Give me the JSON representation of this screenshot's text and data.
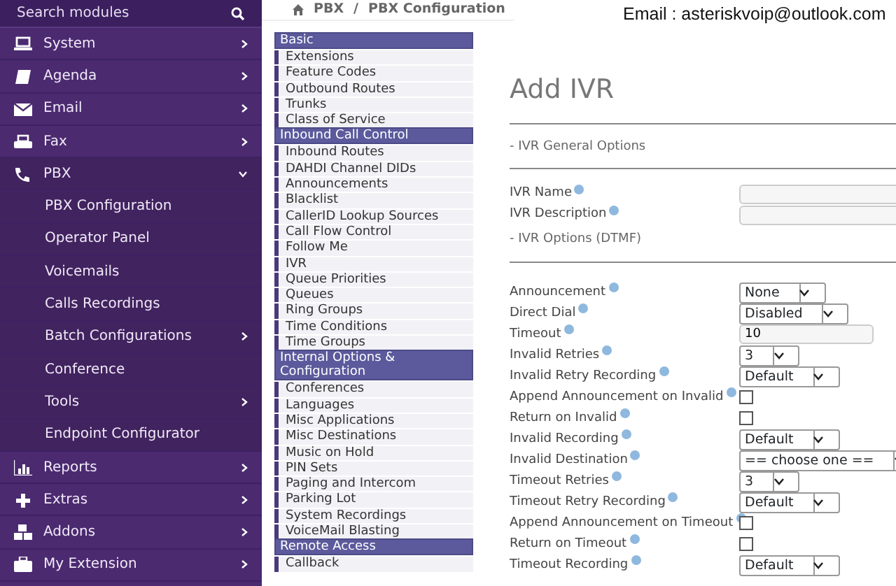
{
  "overlay_text": "Email : asteriskvoip@outlook.com",
  "sidebar": {
    "search": {
      "placeholder": "Search modules"
    },
    "items": [
      {
        "label": "System",
        "expanded": false
      },
      {
        "label": "Agenda",
        "expanded": false
      },
      {
        "label": "Email",
        "expanded": false
      },
      {
        "label": "Fax",
        "expanded": false
      },
      {
        "label": "PBX",
        "expanded": true,
        "children": [
          {
            "label": "PBX Configuration",
            "has_submenu": false
          },
          {
            "label": "Operator Panel",
            "has_submenu": false
          },
          {
            "label": "Voicemails",
            "has_submenu": false
          },
          {
            "label": "Calls Recordings",
            "has_submenu": false
          },
          {
            "label": "Batch Configurations",
            "has_submenu": true
          },
          {
            "label": "Conference",
            "has_submenu": false
          },
          {
            "label": "Tools",
            "has_submenu": true
          },
          {
            "label": "Endpoint Configurator",
            "has_submenu": false
          }
        ]
      },
      {
        "label": "Reports",
        "expanded": false
      },
      {
        "label": "Extras",
        "expanded": false
      },
      {
        "label": "Addons",
        "expanded": false
      },
      {
        "label": "My Extension",
        "expanded": false
      }
    ]
  },
  "breadcrumb": {
    "items": [
      "PBX",
      "PBX Configuration"
    ],
    "separator": "/"
  },
  "module_menu": [
    {
      "title": "Basic",
      "items": [
        "Extensions",
        "Feature Codes",
        "Outbound Routes",
        "Trunks",
        "Class of Service"
      ]
    },
    {
      "title": "Inbound Call Control",
      "items": [
        "Inbound Routes",
        "DAHDI Channel DIDs",
        "Announcements",
        "Blacklist",
        "CallerID Lookup Sources",
        "Call Flow Control",
        "Follow Me",
        "IVR",
        "Queue Priorities",
        "Queues",
        "Ring Groups",
        "Time Conditions",
        "Time Groups"
      ]
    },
    {
      "title": "Internal Options & Configuration",
      "items": [
        "Conferences",
        "Languages",
        "Misc Applications",
        "Misc Destinations",
        "Music on Hold",
        "PIN Sets",
        "Paging and Intercom",
        "Parking Lot",
        "System Recordings",
        "VoiceMail Blasting"
      ]
    },
    {
      "title": "Remote Access",
      "items": [
        "Callback"
      ]
    }
  ],
  "form": {
    "title": "Add IVR",
    "sections": [
      {
        "title": "- IVR General Options",
        "rows": [
          {
            "label": "IVR Name",
            "kind": "text",
            "value": ""
          },
          {
            "label": "IVR Description",
            "kind": "text",
            "value": ""
          }
        ]
      },
      {
        "title": "- IVR Options (DTMF)",
        "rows": [
          {
            "label": "Announcement",
            "kind": "select",
            "value": "None"
          },
          {
            "label": "Direct Dial",
            "kind": "select",
            "value": "Disabled"
          },
          {
            "label": "Timeout",
            "kind": "number",
            "value": "10"
          },
          {
            "label": "Invalid Retries",
            "kind": "select",
            "value": "3"
          },
          {
            "label": "Invalid Retry Recording",
            "kind": "select",
            "value": "Default"
          },
          {
            "label": "Append Announcement on Invalid",
            "kind": "checkbox",
            "checked": false
          },
          {
            "label": "Return on Invalid",
            "kind": "checkbox",
            "checked": false
          },
          {
            "label": "Invalid Recording",
            "kind": "select",
            "value": "Default"
          },
          {
            "label": "Invalid Destination",
            "kind": "select",
            "value": "== choose one =="
          },
          {
            "label": "Timeout Retries",
            "kind": "select",
            "value": "3"
          },
          {
            "label": "Timeout Retry Recording",
            "kind": "select",
            "value": "Default"
          },
          {
            "label": "Append Announcement on Timeout",
            "kind": "checkbox",
            "checked": false
          },
          {
            "label": "Return on Timeout",
            "kind": "checkbox",
            "checked": false
          },
          {
            "label": "Timeout Recording",
            "kind": "select",
            "value": "Default"
          }
        ]
      }
    ]
  }
}
